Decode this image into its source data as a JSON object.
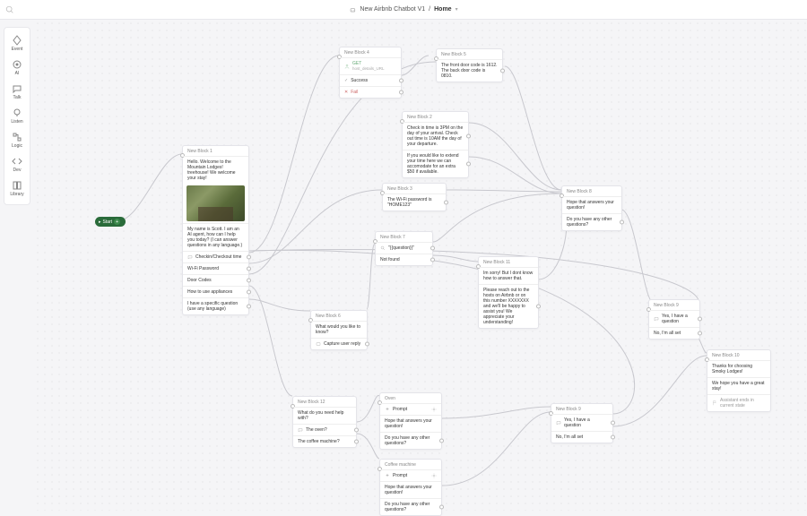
{
  "breadcrumb": {
    "bot_name": "New Airbnb Chatbot V1",
    "sep": "/",
    "page": "Home"
  },
  "sidebar": {
    "items": [
      {
        "label": "Event"
      },
      {
        "label": "AI"
      },
      {
        "label": "Talk"
      },
      {
        "label": "Listen"
      },
      {
        "label": "Logic"
      },
      {
        "label": "Dev"
      },
      {
        "label": "Library"
      }
    ]
  },
  "start": {
    "label": "Start"
  },
  "blocks": {
    "b1": {
      "title": "New Block 1",
      "greeting": "Hello. Welcome to the Mountain Lodges! treehouse! We welcome your stay!",
      "intro": "My name is Scott. I am an AI agent, how can I help you today? (I can answer questions in any language.)",
      "opts": [
        "Checkin/Checkout time",
        "Wi-Fi Password",
        "Door Codes",
        "How to use appliances"
      ],
      "fallback": "I have a specific question (use any language)"
    },
    "b4": {
      "title": "New Block 4",
      "get": "GET",
      "get_sub": "host_details_URL",
      "success": "Success",
      "fail": "Fail"
    },
    "b5": {
      "title": "New Block 5",
      "msg": "The front door code is 1612.\nThe back door code is 0810."
    },
    "b2": {
      "title": "New Block 2",
      "msg1": "Check in time is 3PM on the day of your arrival. Check out time is 10AM the day of your departure.",
      "msg2": "If you would like to extend your time here we can accomodate for an extra $50 if available."
    },
    "b3": {
      "title": "New Block 3",
      "msg": "The Wi-Fi password is \"HOME123\""
    },
    "b7": {
      "title": "New Block 7",
      "q": "\"{{question}}\"",
      "nf": "Not found"
    },
    "b6": {
      "title": "New Block 6",
      "msg": "What would you like to know?",
      "cap": "Capture user reply"
    },
    "b11": {
      "title": "New Block 11",
      "msg1": "Im sorry! But I dont know how to answer that.",
      "msg2": "Please reach out to the hosts on Airbnb or on this number XXXXXXX and we'll be happy to assist you! We appreciate your understanding!"
    },
    "b8": {
      "title": "New Block 8",
      "msg": "Hope that answers your question!",
      "q": "Do you have any other questions?"
    },
    "b9": {
      "title": "New Block 9",
      "yes": "Yes, I have a question",
      "no": "No, I'm all set"
    },
    "b12": {
      "title": "New Block 12",
      "msg": "What do you need help with?",
      "o1": "The oven?",
      "o2": "The coffee machine?"
    },
    "bOven": {
      "title": "Oven",
      "p": "Prompt",
      "msg": "Hope that answers your question!",
      "q": "Do you have any other questions?"
    },
    "bCoffee": {
      "title": "Coffee machine",
      "p": "Prompt",
      "msg": "Hope that answers your question!",
      "q": "Do you have any other questions?"
    },
    "b9b": {
      "title": "New Block 9",
      "yes": "Yes, I have a question",
      "no": "No, I'm all set"
    },
    "b10": {
      "title": "New Block 10",
      "msg1": "Thanks for choosing Smoky Lodges!",
      "msg2": "We hope you have a great stay!",
      "asst": "Assistant ends in current state"
    }
  }
}
